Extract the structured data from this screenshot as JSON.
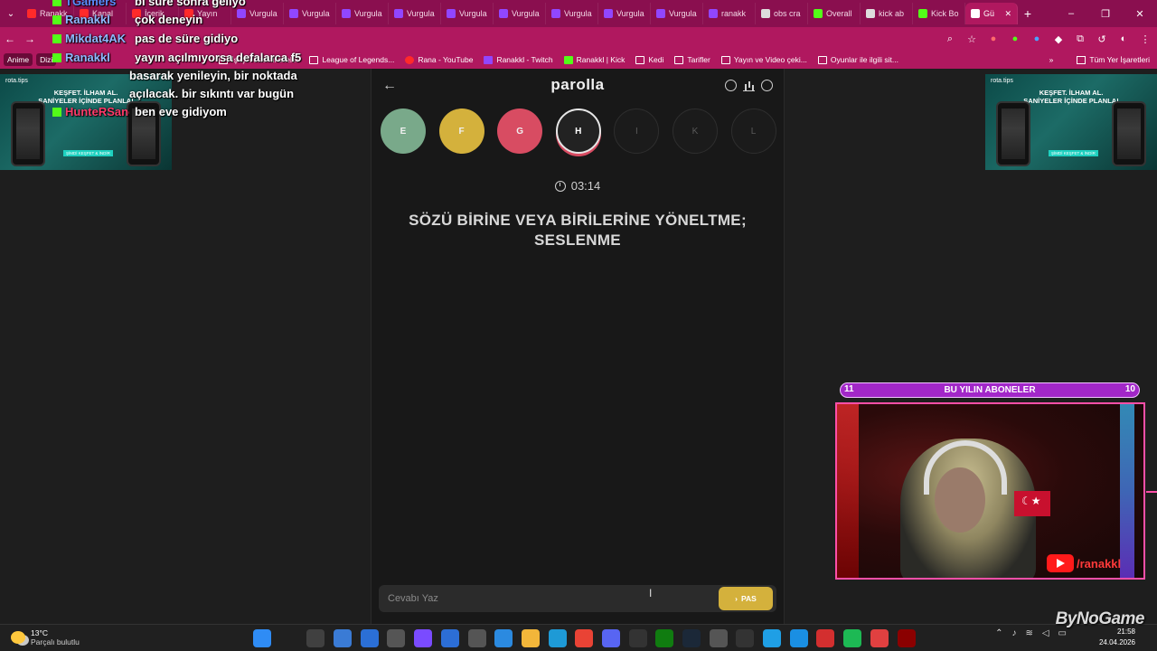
{
  "browser": {
    "tabs": [
      {
        "label": "Ranakk",
        "color": "#ff2a2a"
      },
      {
        "label": "Kanal",
        "color": "#ff2a2a"
      },
      {
        "label": "İçerik",
        "color": "#ff2a2a"
      },
      {
        "label": "Yayın",
        "color": "#ff2a2a"
      },
      {
        "label": "Vurgula",
        "color": "#9146ff"
      },
      {
        "label": "Vurgula",
        "color": "#9146ff"
      },
      {
        "label": "Vurgula",
        "color": "#9146ff"
      },
      {
        "label": "Vurgula",
        "color": "#9146ff"
      },
      {
        "label": "Vurgula",
        "color": "#9146ff"
      },
      {
        "label": "Vurgula",
        "color": "#9146ff"
      },
      {
        "label": "Vurgula",
        "color": "#9146ff"
      },
      {
        "label": "Vurgula",
        "color": "#9146ff"
      },
      {
        "label": "Vurgula",
        "color": "#9146ff"
      },
      {
        "label": "ranakk",
        "color": "#9146ff"
      },
      {
        "label": "obs cra",
        "color": "#dddddd"
      },
      {
        "label": "Overall",
        "color": "#53fc18"
      },
      {
        "label": "kick ab",
        "color": "#dddddd"
      },
      {
        "label": "Kick Bo",
        "color": "#53fc18"
      },
      {
        "label": "Gü",
        "color": "#ffffff",
        "active": true
      }
    ],
    "new_tab": "+",
    "window_controls": [
      "–",
      "❐",
      "✕"
    ],
    "bookmarks": [
      {
        "label": "Anime",
        "icon": "chip"
      },
      {
        "label": "Dizi",
        "icon": "chip"
      },
      {
        "label": "İş için önemli siteler",
        "icon": "folder"
      },
      {
        "label": "League of Legends...",
        "icon": "folder"
      },
      {
        "label": "Rana - YouTube",
        "icon": "yt"
      },
      {
        "label": "Ranakkl - Twitch",
        "icon": "tw"
      },
      {
        "label": "Ranakkl | Kick",
        "icon": "k"
      },
      {
        "label": "Kedi",
        "icon": "folder"
      },
      {
        "label": "Tarifler",
        "icon": "folder"
      },
      {
        "label": "Yayın ve Video çeki...",
        "icon": "folder"
      },
      {
        "label": "Oyunlar ile ilgili sit...",
        "icon": "folder"
      }
    ],
    "bookmarks_more": "»",
    "all_bookmarks": "Tüm Yer İşaretleri"
  },
  "chat": [
    {
      "user": "TGamers",
      "user_color": "#5b8cff",
      "text": "bi süre sonra geliyo"
    },
    {
      "user": "Ranakkl",
      "user_color": "#8fb8ff",
      "text": "çok deneyin"
    },
    {
      "user": "Mikdat4AK",
      "user_color": "#8fb8ff",
      "text": "pas de süre gidiyo"
    },
    {
      "user": "Ranakkl",
      "user_color": "#8fb8ff",
      "text": "yayın açılmıyorsa defalarca f5"
    },
    {
      "user": "",
      "user_color": "#ffffff",
      "text": "basarak yenileyin, bir noktada"
    },
    {
      "user": "",
      "user_color": "#ffffff",
      "text": "açılacak. bir sıkıntı var bugün"
    },
    {
      "user": "HunteRSanch...",
      "user_color": "#ff3a6a",
      "text": "ben eve gidiyom"
    }
  ],
  "ads": {
    "brand": "rota.tips",
    "headline_line1": "KEŞFET. İLHAM AL.",
    "headline_line2": "SANİYELER İÇİNDE PLANLA!",
    "cta": "ŞİMDİ KEŞFET & İNDİR"
  },
  "game": {
    "title": "parolla",
    "back": "←",
    "letters": [
      {
        "char": "E",
        "state": "correct"
      },
      {
        "char": "F",
        "state": "pass"
      },
      {
        "char": "G",
        "state": "wrong"
      },
      {
        "char": "H",
        "state": "current"
      },
      {
        "char": "I",
        "state": "pending"
      },
      {
        "char": "K",
        "state": "pending"
      },
      {
        "char": "L",
        "state": "pending"
      }
    ],
    "timer": "03:14",
    "question": "SÖZÜ BİRİNE VEYA BİRİLERİNE YÖNELTME; SESLENME",
    "answer_placeholder": "Cevabı Yaz",
    "pass_label": "PAS",
    "colors": {
      "correct": "#79a98a",
      "pass": "#d4b13c",
      "wrong": "#d84c62"
    }
  },
  "overlay": {
    "sub_title": "BU YILIN ABONELER",
    "sub_left": "11",
    "sub_right": "10",
    "yt_handle": "/ranakkl",
    "watermark": "ByNoGame"
  },
  "taskbar": {
    "temp": "13°C",
    "weather": "Parçalı bulutlu",
    "time": "21:58",
    "date": "24.04.2026",
    "icons": [
      {
        "name": "windows",
        "color": "#2f8cf5"
      },
      {
        "name": "search",
        "color": "#202020"
      },
      {
        "name": "task-view",
        "color": "#404040"
      },
      {
        "name": "app",
        "color": "#3a7bd5"
      },
      {
        "name": "mail",
        "color": "#2b6fd6"
      },
      {
        "name": "app-3d",
        "color": "#555555"
      },
      {
        "name": "copilot",
        "color": "#7a4bff"
      },
      {
        "name": "store",
        "color": "#2c6ed6"
      },
      {
        "name": "settings",
        "color": "#555555"
      },
      {
        "name": "photos",
        "color": "#2b8ae0"
      },
      {
        "name": "folder",
        "color": "#f2b63a"
      },
      {
        "name": "edge",
        "color": "#1e9ad6"
      },
      {
        "name": "chrome",
        "color": "#e94335"
      },
      {
        "name": "discord",
        "color": "#5865f2"
      },
      {
        "name": "obs",
        "color": "#333333"
      },
      {
        "name": "xbox",
        "color": "#107c10"
      },
      {
        "name": "steam",
        "color": "#1b2838"
      },
      {
        "name": "app-ring",
        "color": "#555555"
      },
      {
        "name": "epic",
        "color": "#333333"
      },
      {
        "name": "battle-net",
        "color": "#1f9fe5"
      },
      {
        "name": "app-blue",
        "color": "#1a8fe3"
      },
      {
        "name": "app-red",
        "color": "#d32f2f"
      },
      {
        "name": "spotify",
        "color": "#1db954"
      },
      {
        "name": "game",
        "color": "#e04040"
      },
      {
        "name": "app-dark",
        "color": "#8b0000"
      }
    ]
  }
}
